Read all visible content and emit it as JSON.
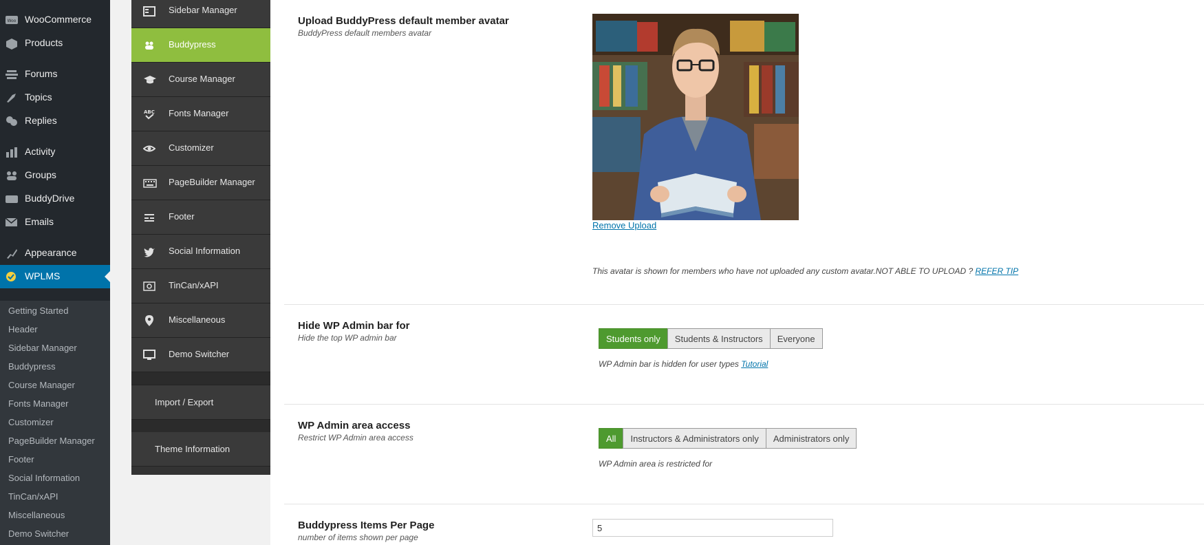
{
  "wp_menu": {
    "items": [
      {
        "label": "WooCommerce",
        "icon": "woocommerce-icon"
      },
      {
        "label": "Products",
        "icon": "products-icon"
      },
      {
        "label": "Forums",
        "icon": "forums-icon"
      },
      {
        "label": "Topics",
        "icon": "topics-icon"
      },
      {
        "label": "Replies",
        "icon": "replies-icon"
      },
      {
        "label": "Activity",
        "icon": "activity-icon"
      },
      {
        "label": "Groups",
        "icon": "groups-icon"
      },
      {
        "label": "BuddyDrive",
        "icon": "buddydrive-icon"
      },
      {
        "label": "Emails",
        "icon": "emails-icon"
      },
      {
        "label": "Appearance",
        "icon": "appearance-icon"
      },
      {
        "label": "WPLMS",
        "icon": "wplms-icon"
      }
    ],
    "submenu": [
      "Getting Started",
      "Header",
      "Sidebar Manager",
      "Buddypress",
      "Course Manager",
      "Fonts Manager",
      "Customizer",
      "PageBuilder Manager",
      "Footer",
      "Social Information",
      "TinCan/xAPI",
      "Miscellaneous",
      "Demo Switcher"
    ]
  },
  "options_nav": {
    "items": [
      {
        "label": "Sidebar Manager",
        "icon": "sidebar-icon"
      },
      {
        "label": "Buddypress",
        "icon": "buddypress-icon"
      },
      {
        "label": "Course Manager",
        "icon": "graduation-cap-icon"
      },
      {
        "label": "Fonts Manager",
        "icon": "spellcheck-icon"
      },
      {
        "label": "Customizer",
        "icon": "eye-icon"
      },
      {
        "label": "PageBuilder Manager",
        "icon": "keyboard-icon"
      },
      {
        "label": "Footer",
        "icon": "footer-icon"
      },
      {
        "label": "Social Information",
        "icon": "twitter-icon"
      },
      {
        "label": "TinCan/xAPI",
        "icon": "tincan-icon"
      },
      {
        "label": "Miscellaneous",
        "icon": "map-pin-icon"
      },
      {
        "label": "Demo Switcher",
        "icon": "monitor-icon"
      }
    ],
    "import_export": "Import / Export",
    "theme_information": "Theme Information"
  },
  "avatar_section": {
    "title": "Upload BuddyPress default member avatar",
    "subtitle": "BuddyPress default members avatar",
    "remove_link": "Remove Upload",
    "description": "This avatar is shown for members who have not uploaded any custom avatar.NOT ABLE TO UPLOAD ?",
    "refer_link": "REFER TIP"
  },
  "adminbar_section": {
    "title": "Hide WP Admin bar for",
    "subtitle": "Hide the top WP admin bar",
    "options": [
      "Students only",
      "Students & Instructors",
      "Everyone"
    ],
    "selected": "Students only",
    "description": "WP Admin bar is hidden for user types",
    "tutorial_link": "Tutorial"
  },
  "adminarea_section": {
    "title": "WP Admin area access",
    "subtitle": "Restrict WP Admin area access",
    "options": [
      "All",
      "Instructors & Administrators only",
      "Administrators only"
    ],
    "selected": "All",
    "description": "WP Admin area is restricted for"
  },
  "items_section": {
    "title": "Buddypress Items Per Page",
    "subtitle": "number of items shown per page",
    "value": "5"
  },
  "colors": {
    "active_green": "#8fbe3f",
    "selected_button": "#4e9a2f",
    "wp_blue": "#0073aa",
    "wp_dark": "#23282d"
  }
}
